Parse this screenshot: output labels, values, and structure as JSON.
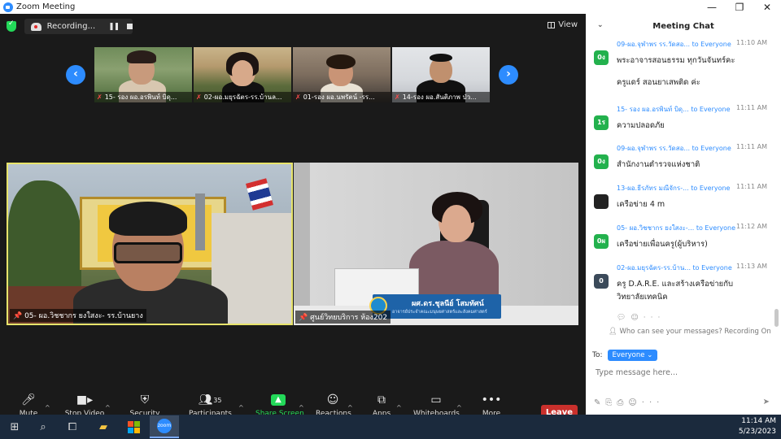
{
  "window": {
    "title": "Zoom Meeting",
    "controls": [
      "minimize",
      "restore",
      "close"
    ]
  },
  "topbar": {
    "recording_label": "Recording...",
    "view_label": "View"
  },
  "thumbnails": [
    {
      "label": "15- รอง ผอ.อรพินท์ บิดุ..."
    },
    {
      "label": "02-ผอ.มยุรฉัตร-รร.บ้านล..."
    },
    {
      "label": "01-รอง ผอ.นพรัตน์ -รร..."
    },
    {
      "label": "14-รอง ผอ.สันติภาพ ป่ว..."
    }
  ],
  "main_videos": {
    "left_name": "05- ผอ.วิชชากร ยงใสงะ- รร.บ้านยาง",
    "right_name": "ศูนย์วิทยบริการ ห้อง202",
    "right_banner_name": "ผศ.ดร.ชุลนีย์ โสมทัศน์",
    "right_banner_sub": "อาจารย์ประจำคณะมนุษยศาสตร์และสังคมศาสตร์"
  },
  "toolbar": {
    "mute": "Mute",
    "stop_video": "Stop Video",
    "security": "Security",
    "participants": "Participants",
    "participants_count": "35",
    "share_screen": "Share Screen",
    "reactions": "Reactions",
    "apps": "Apps",
    "whiteboards": "Whiteboards",
    "more": "More",
    "leave": "Leave"
  },
  "chat": {
    "title": "Meeting Chat",
    "messages": [
      {
        "avatar": "0ง",
        "avatar_color": "#23b14d",
        "sender": "09-ผอ.จุฬาพร  รร.วัดสอ...",
        "to": "to Everyone",
        "time": "11:10 AM",
        "lines": [
          "พระอาจารสอนธรรม ทุกวันจันทร์คะ",
          "ครูแดร์ สอนยาเสพติด ค่ะ"
        ]
      },
      {
        "avatar": "1ร",
        "avatar_color": "#23b14d",
        "sender": "15- รอง ผอ.อรพินท์ บิดุ...",
        "to": "to Everyone",
        "time": "11:11 AM",
        "lines": [
          "ความปลอดภัย"
        ]
      },
      {
        "avatar": "0ง",
        "avatar_color": "#23b14d",
        "sender": "09-ผอ.จุฬาพร  รร.วัดสอ...",
        "to": "to Everyone",
        "time": "11:11 AM",
        "lines": [
          "สำนักงานตำรวจแห่งชาติ"
        ]
      },
      {
        "avatar": "",
        "avatar_color": "#222222",
        "sender": "13-ผอ.ธีรภัทร มณีจักร-...",
        "to": "to Everyone",
        "time": "11:11 AM",
        "lines": [
          "เครือข่าย 4 m"
        ]
      },
      {
        "avatar": "0ผ",
        "avatar_color": "#23b14d",
        "sender": "05- ผอ.วิชชากร ยงใสงะ-...",
        "to": "to Everyone",
        "time": "11:12 AM",
        "lines": [
          "เครือข่ายเพื่อนครู(ผู้บริหาร)"
        ]
      },
      {
        "avatar": "0",
        "avatar_color": "#3b4a5a",
        "sender": "02-ผอ.มยุรฉัตร-รร.บ้าน...",
        "to": "to Everyone",
        "time": "11:13 AM",
        "lines": [
          "ครู D.A.R.E.  และสร้างเครือข่ายกับ",
          "วิทยาลัยเทคนิค"
        ]
      }
    ],
    "privacy_note": "Who can see your messages? Recording On",
    "to_label": "To:",
    "recipient": "Everyone",
    "input_placeholder": "Type message here..."
  },
  "taskbar": {
    "time": "11:14 AM",
    "date": "5/23/2023"
  },
  "colors": {
    "accent": "#2d8cff",
    "share_green": "#23d959",
    "leave_red": "#c9302c",
    "active_speaker_border": "#e8e46b"
  }
}
